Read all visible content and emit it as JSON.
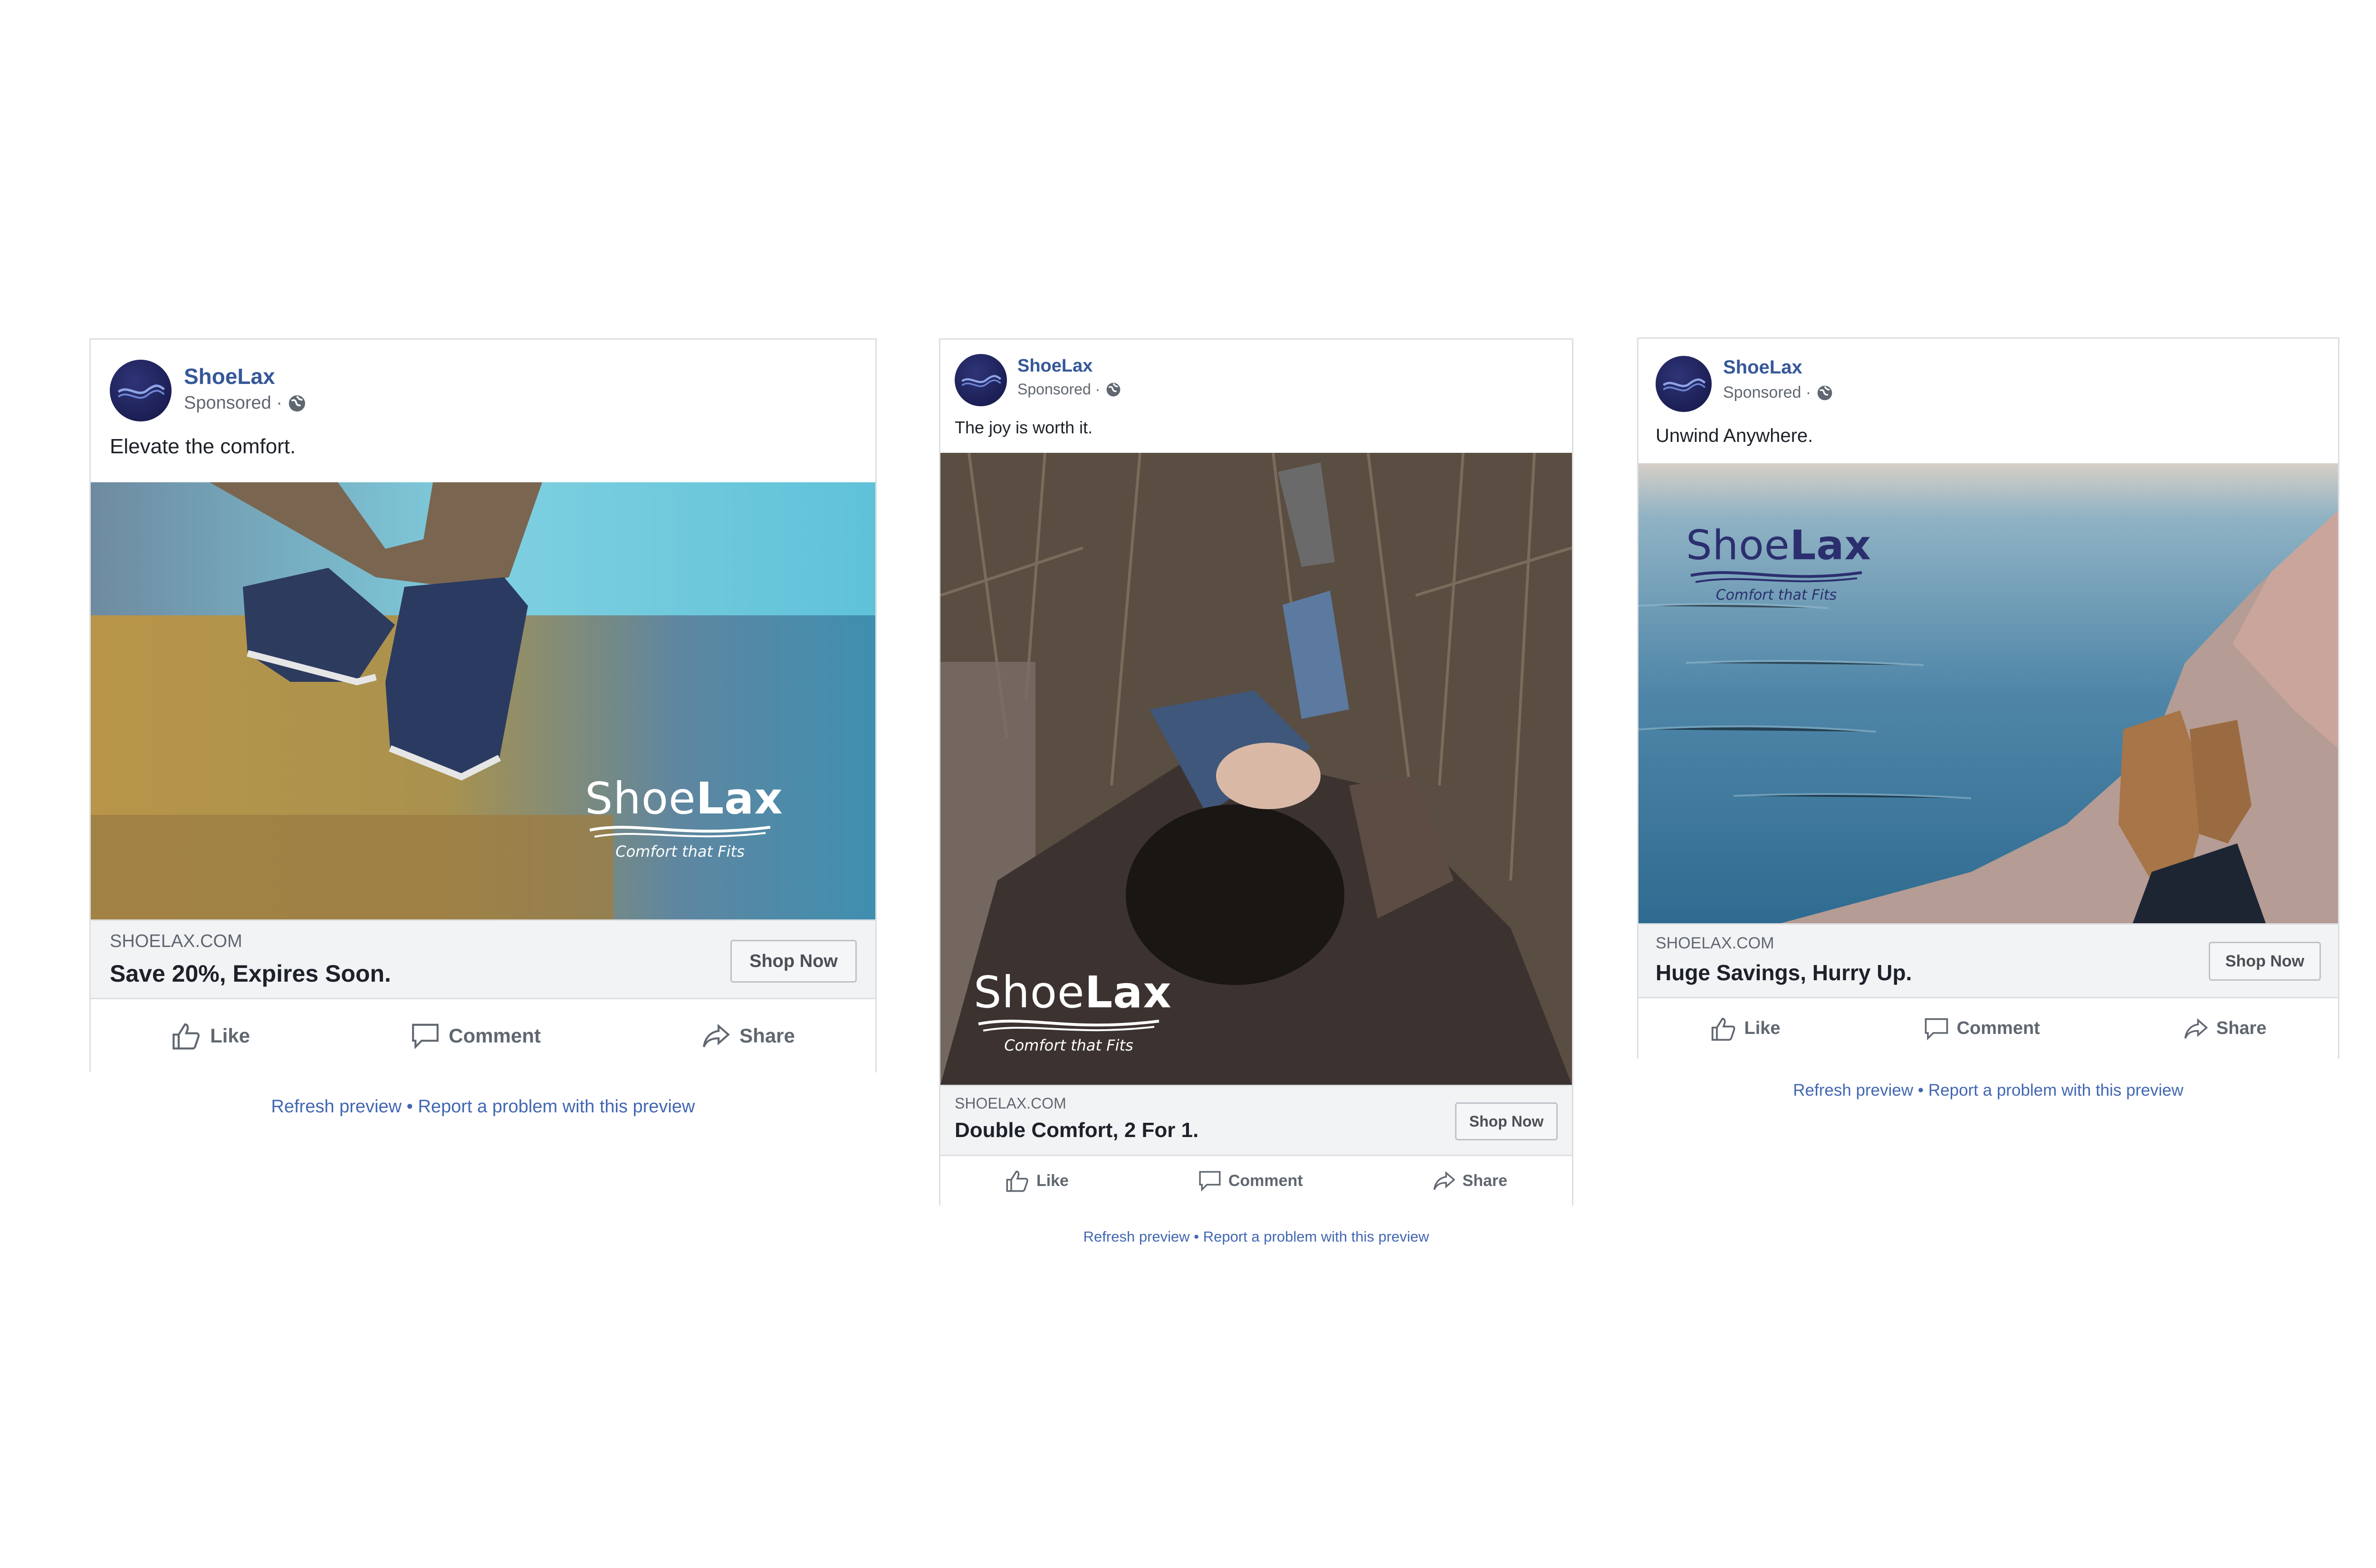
{
  "ads": [
    {
      "page_name": "ShoeLax",
      "sponsored": "Sponsored ·",
      "caption": "Elevate the comfort.",
      "brand_name_thin": "Shoe",
      "brand_name_bold": "Lax",
      "brand_tagline": "Comfort that Fits",
      "domain": "SHOELAX.COM",
      "headline": "Save 20%, Expires Soon.",
      "cta": "Shop Now",
      "like": "Like",
      "comment": "Comment",
      "share": "Share",
      "refresh": "Refresh preview",
      "separator": "•",
      "report": "Report a problem with this preview"
    },
    {
      "page_name": "ShoeLax",
      "sponsored": "Sponsored ·",
      "caption": "The joy is worth it.",
      "brand_name_thin": "Shoe",
      "brand_name_bold": "Lax",
      "brand_tagline": "Comfort that Fits",
      "domain": "SHOELAX.COM",
      "headline": "Double Comfort, 2 For 1.",
      "cta": "Shop Now",
      "like": "Like",
      "comment": "Comment",
      "share": "Share",
      "refresh": "Refresh preview",
      "separator": "•",
      "report": "Report a problem with this preview"
    },
    {
      "page_name": "ShoeLax",
      "sponsored": "Sponsored ·",
      "caption": "Unwind Anywhere.",
      "brand_name_thin": "Shoe",
      "brand_name_bold": "Lax",
      "brand_tagline": "Comfort that Fits",
      "domain": "SHOELAX.COM",
      "headline": "Huge Savings, Hurry Up.",
      "cta": "Shop Now",
      "like": "Like",
      "comment": "Comment",
      "share": "Share",
      "refresh": "Refresh preview",
      "separator": "•",
      "report": "Report a problem with this preview"
    }
  ],
  "colors": {
    "page_name": "#365899",
    "link": "#4267b2",
    "brand_navy": "#1c1f55"
  }
}
